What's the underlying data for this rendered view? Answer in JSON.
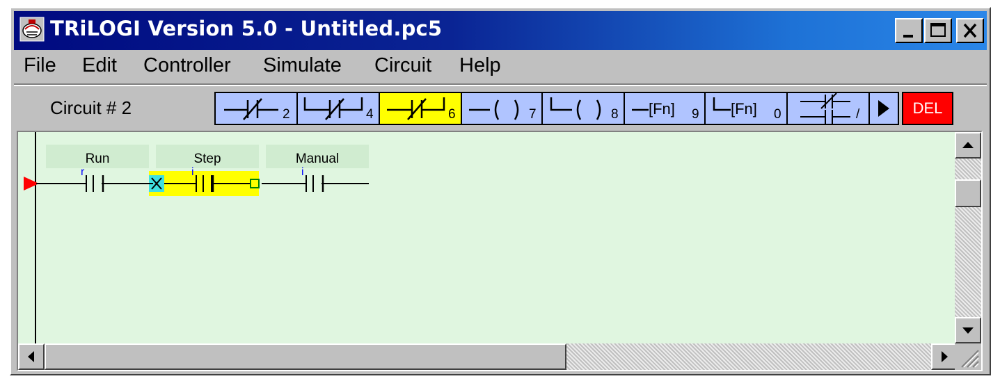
{
  "window": {
    "title": "TRiLOGI Version 5.0 - Untitled.pc5",
    "icon": "trilogi-app-icon",
    "controls": [
      "minimize-icon",
      "maximize-icon",
      "close-icon"
    ]
  },
  "menu": {
    "items": [
      "File",
      "Edit",
      "Controller",
      "Simulate",
      "Circuit",
      "Help"
    ]
  },
  "toolbar": {
    "circuit_label": "Circuit # 2",
    "buttons": [
      {
        "icon": "series-nc-contact-icon",
        "hotkey": "2",
        "active": false
      },
      {
        "icon": "parallel-nc-contact-icon",
        "hotkey": "4",
        "active": false
      },
      {
        "icon": "nc-contact-branch-icon",
        "hotkey": "6",
        "active": true
      },
      {
        "icon": "output-coil-icon",
        "hotkey": "7",
        "active": false
      },
      {
        "icon": "parallel-output-coil-icon",
        "hotkey": "8",
        "active": false
      },
      {
        "icon": "function-block-icon",
        "label": "[Fn]",
        "hotkey": "9",
        "active": false
      },
      {
        "icon": "parallel-function-block-icon",
        "label": "[Fn]",
        "hotkey": "0",
        "active": false
      },
      {
        "icon": "invert-contact-icon",
        "hotkey": "/",
        "active": false
      },
      {
        "icon": "play-icon",
        "active": false
      },
      {
        "icon": "delete-icon",
        "label": "DEL",
        "active": false
      }
    ]
  },
  "ladder": {
    "contacts": [
      {
        "label": "Run",
        "mark": "r"
      },
      {
        "label": "Step",
        "mark": "i"
      },
      {
        "label": "Manual",
        "mark": "i"
      }
    ]
  },
  "colors": {
    "title_bar_start": "#000a80",
    "title_bar_end": "#2a86e8",
    "toolbar_button": "#b0c4ff",
    "active_button": "#ffff00",
    "delete_button": "#ff0000",
    "ladder_background": "#e0f6e0",
    "cursor_marker": "#ff0000"
  }
}
